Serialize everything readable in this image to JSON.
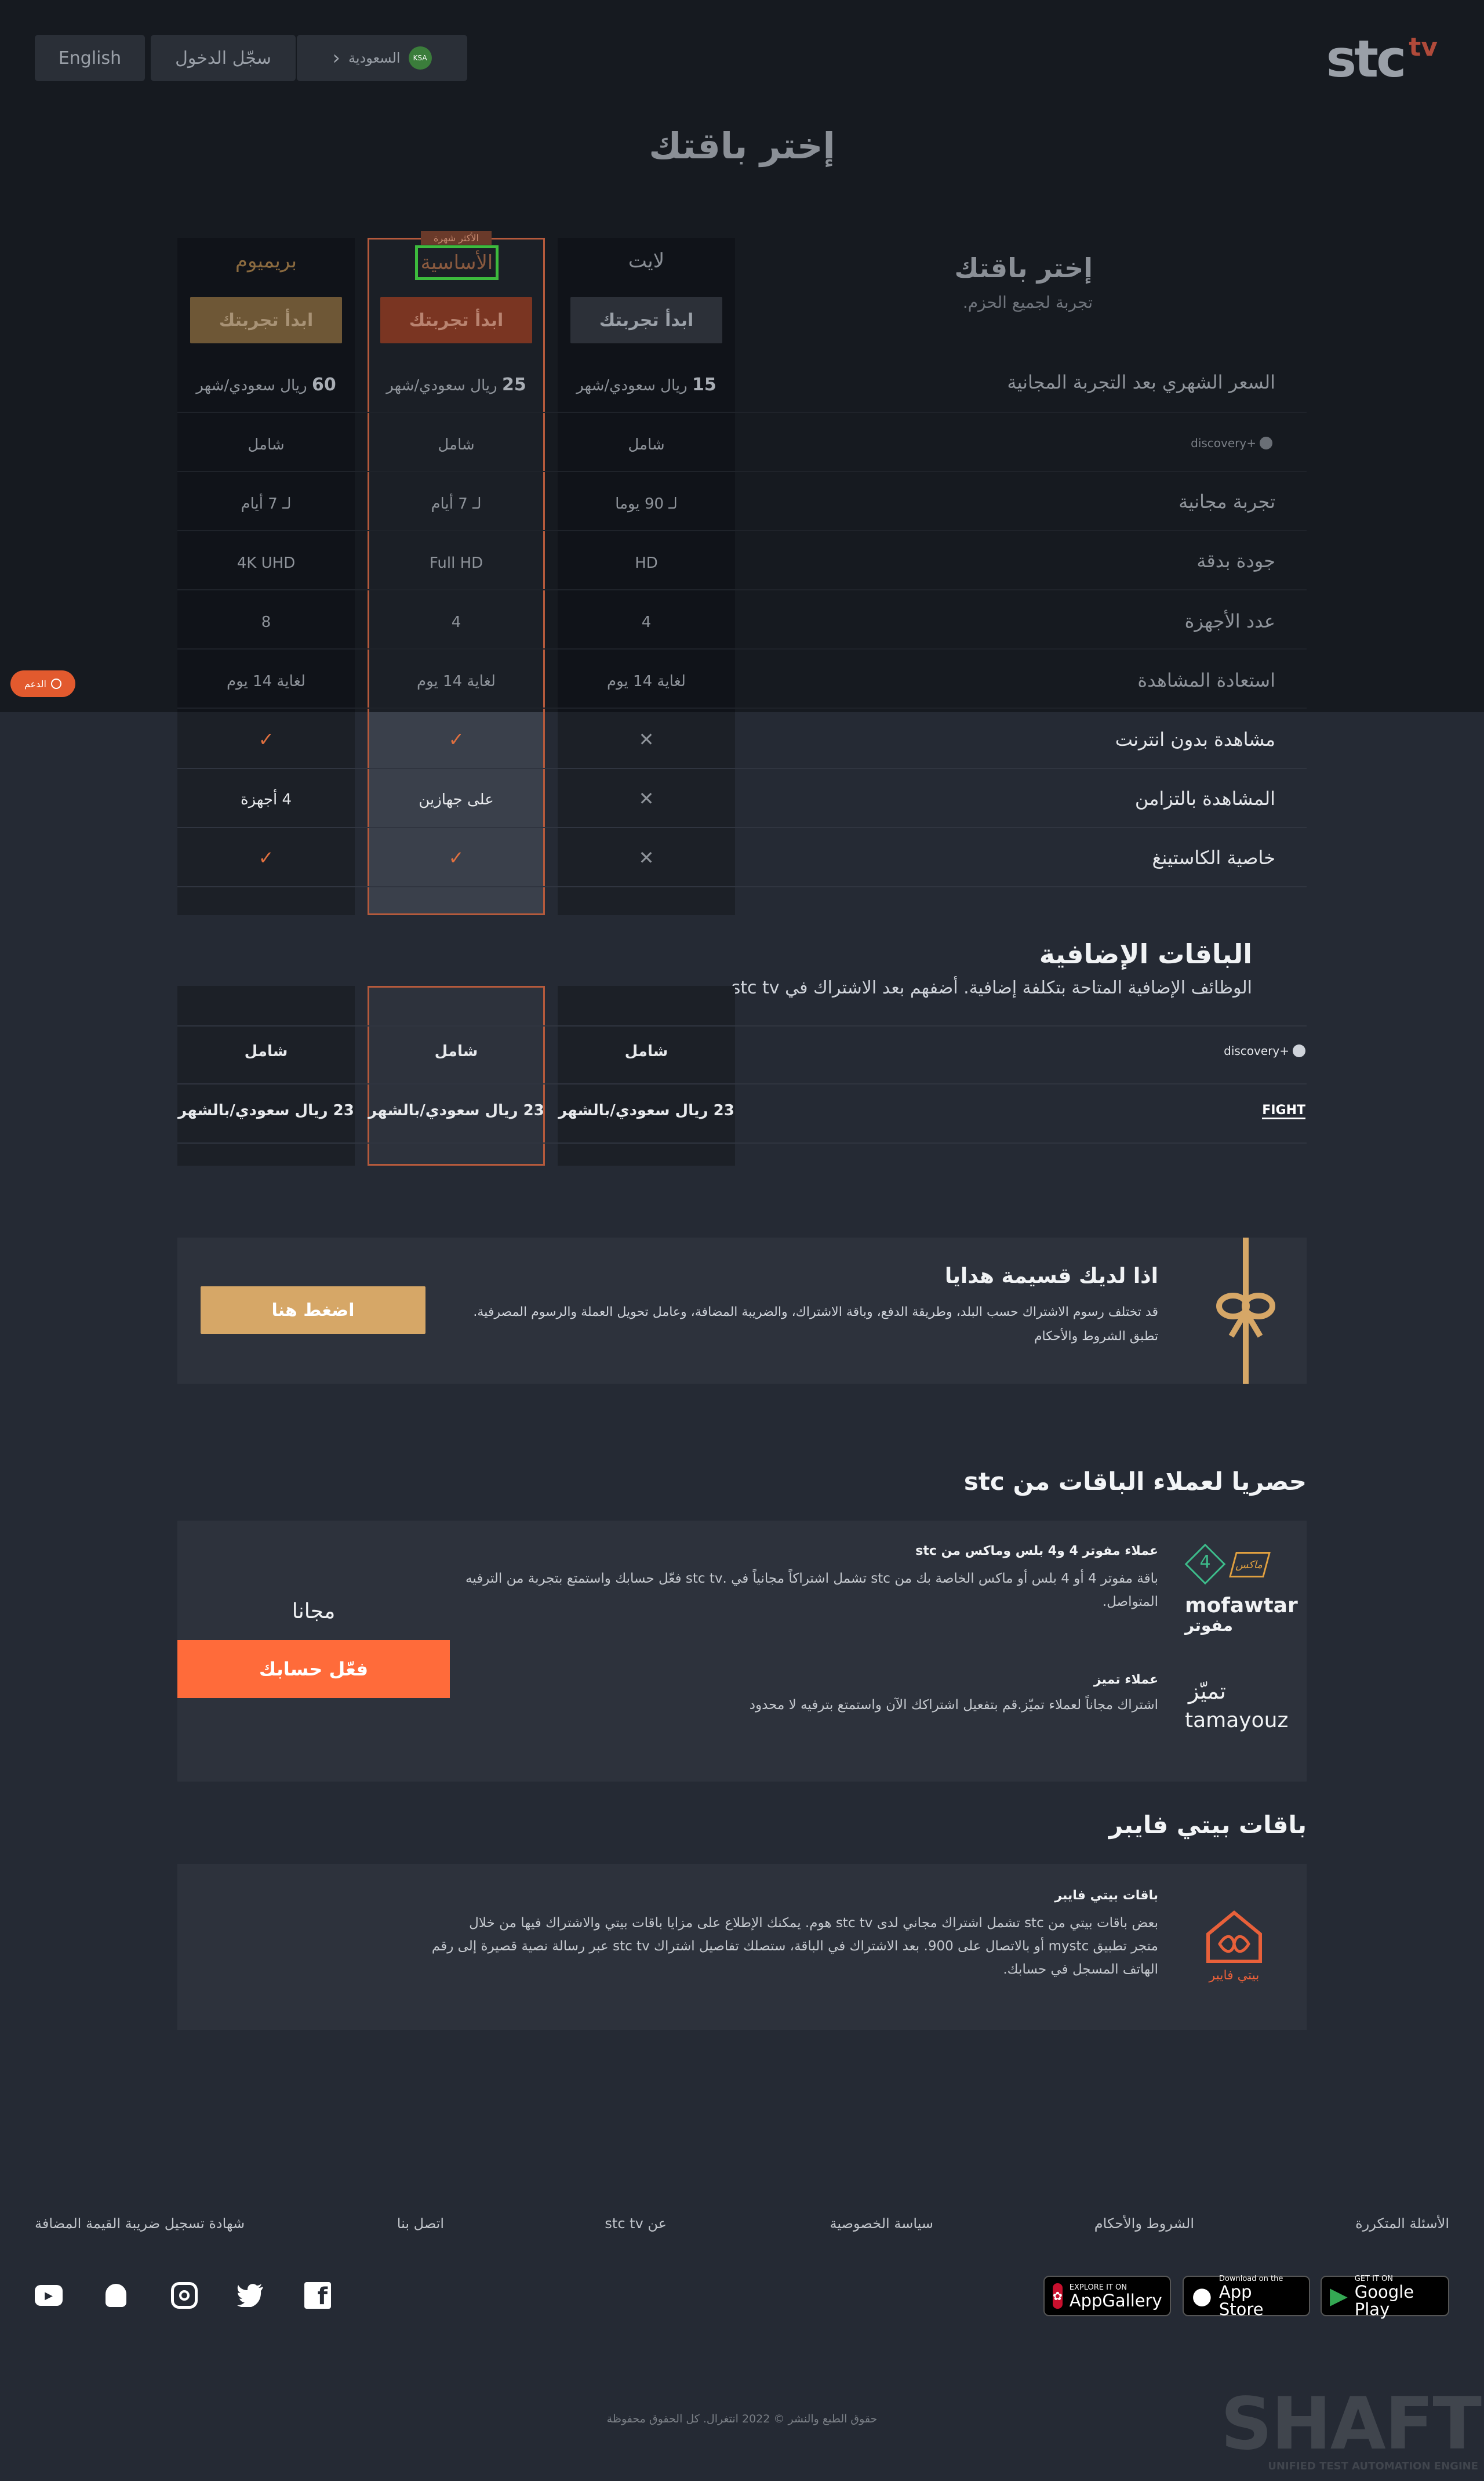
{
  "header": {
    "language": "English",
    "login": "سجّل الدخول",
    "country": "السعودية",
    "country_code": "KSA",
    "logo_text": "stc",
    "logo_suffix": "tv"
  },
  "page_title": "إختر باقتك",
  "support_label": "الدعم",
  "plans_intro": {
    "title": "إختر باقتك",
    "subtitle": "تجربة لجميع الحزم."
  },
  "plans": [
    {
      "name": "بريميوم",
      "trial": "ابدأ تجربتك",
      "price_num": "60",
      "price_unit": "ريال سعودي/شهر",
      "discovery": "شامل",
      "free_trial": "لـ 7 أيام",
      "quality": "4K UHD",
      "devices": "8",
      "catchup": "لغاية 14 يوم",
      "offline": "check",
      "concurrent": "4 أجهزة",
      "casting": "check"
    },
    {
      "name": "الأساسية",
      "badge": "الأكثر شهرة",
      "trial": "ابدأ تجربتك",
      "price_num": "25",
      "price_unit": "ريال سعودي/شهر",
      "discovery": "شامل",
      "free_trial": "لـ 7 أيام",
      "quality": "Full HD",
      "devices": "4",
      "catchup": "لغاية 14 يوم",
      "offline": "check",
      "concurrent": "على جهازين",
      "casting": "check"
    },
    {
      "name": "لايت",
      "trial": "ابدأ تجربتك",
      "price_num": "15",
      "price_unit": "ريال سعودي/شهر",
      "discovery": "شامل",
      "free_trial": "لـ 90 يوما",
      "quality": "HD",
      "devices": "4",
      "catchup": "لغاية 14 يوم",
      "offline": "cross",
      "concurrent": "cross",
      "casting": "cross"
    }
  ],
  "row_labels": {
    "price": "السعر الشهري بعد التجربة المجانية",
    "discovery": "discovery+",
    "free_trial": "تجربة مجانية",
    "quality": "جودة بدقة",
    "devices": "عدد الأجهزة",
    "catchup": "استعادة المشاهدة",
    "offline": "مشاهدة بدون انترنت",
    "concurrent": "المشاهدة بالتزامن",
    "casting": "خاصية الكاستينغ"
  },
  "addons": {
    "title": "الباقات الإضافية",
    "subtitle": "الوظائف الإضافية المتاحة بتكلفة إضافية. أضفهم بعد الاشتراك في stc tv",
    "rows": [
      {
        "label": "discovery+",
        "values": [
          "شامل",
          "شامل",
          "شامل"
        ]
      },
      {
        "label": "FIGHT",
        "values": [
          "23 ريال سعودي/بالشهر",
          "23 ريال سعودي/بالشهر",
          "23 ريال سعودي/بالشهر"
        ]
      }
    ]
  },
  "gift": {
    "title": "اذا لديك قسيمة هدايا",
    "text": "قد تختلف رسوم الاشتراك حسب البلد، وطريقة الدفع، وباقة الاشتراك، والضريبة المضافة، وعامل تحويل العملة والرسوم المصرفية.",
    "terms": "تطبق الشروط والأحكام",
    "button": "اضغط هنا"
  },
  "stc_customers": {
    "title": "حصريا لعملاء الباقات من stc",
    "free_label": "مجانا",
    "activate": "فعّل حسابك",
    "mofawtar_title": "عملاء مفوتر 4 و4 بلس وماكس من stc",
    "mofawtar_text1": "باقة مفوتر 4 أو 4 بلس أو ماكس الخاصة بك من stc تشمل اشتراكاً مجانياً في .stc tv فعّل حسابك واستمتع بتجربة من الترفيه",
    "mofawtar_text2": "المتواصل.",
    "mofawtar_logo_en": "mofawtar",
    "mofawtar_logo_ar": "مفوتر",
    "mofawtar_badge": "ماكس",
    "mofawtar_num": "4",
    "tamayouz_title": "عملاء تميز",
    "tamayouz_text": "اشتراك مجاناً لعملاء تميّز.قم بتفعيل اشتراكك الآن واستمتع بترفيه لا محدود",
    "tamayouz_ar": "تميّز",
    "tamayouz_en": "tamayouz"
  },
  "fiber": {
    "title": "باقات بيتي فايبر",
    "subtitle": "باقات بيتي فايبر",
    "line1": "بعض باقات بيتي من stc تشمل اشتراك مجاني لدى stc tv هوم. يمكنك الإطلاع على مزايا باقات بيتي والاشتراك فيها من خلال",
    "line2": "متجر تطبيق mystc أو بالاتصال على 900. بعد الاشتراك في الباقة، ستصلك تفاصيل اشتراك stc tv عبر رسالة نصية قصيرة إلى رقم",
    "line3": "الهاتف المسجل في حسابك.",
    "logo_label": "بيتي فايبر"
  },
  "footer": {
    "links": [
      "الأسئلة المتكررة",
      "الشروط والأحكام",
      "سياسة الخصوصية",
      "عن stc tv",
      "اتصل بنا",
      "شهادة تسجيل ضريبة القيمة المضافة"
    ],
    "stores": [
      {
        "small": "GET IT ON",
        "large": "Google Play"
      },
      {
        "small": "Download on the",
        "large": "App Store"
      },
      {
        "small": "EXPLORE IT ON",
        "large": "AppGallery"
      }
    ],
    "copyright": "حقوق الطبع والنشر © 2022 انتغرال. كل الحقوق محفوظة",
    "watermark": "SHAFT",
    "watermark_sub": "UNIFIED TEST AUTOMATION ENGINE"
  }
}
